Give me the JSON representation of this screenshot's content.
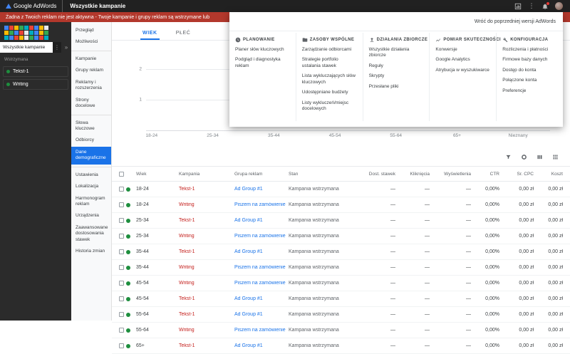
{
  "colors": {
    "accent_blue": "#1a73e8",
    "alert_red": "#b3382c",
    "campaign_link_red": "#c5221f",
    "adgroup_link_blue": "#1a73e8",
    "status_green": "#1e8e3e",
    "topbar_bg": "#212121",
    "sidebar_bg": "#2b2b2b"
  },
  "topbar": {
    "brand": "Google AdWords",
    "title": "Wszystkie kampanie",
    "icons": [
      "reports-icon",
      "more-vert-icon",
      "notifications-icon",
      "avatar"
    ]
  },
  "alert": {
    "text": "Żadna z Twoich reklam nie jest aktywna - Twoje kampanie i grupy reklam są wstrzymane lub"
  },
  "campaign_nav": {
    "all_campaigns_label": "Wszystkie kampanie",
    "section_label": "Wstrzymana",
    "campaigns": [
      "Tekst-1",
      "Writing"
    ],
    "mosaic_colors": [
      "#4285f4",
      "#ea4335",
      "#fbbc04",
      "#34a853",
      "#00acc1",
      "#ea4335",
      "#4285f4",
      "#fbbc04",
      "#e8eaed",
      "#fbbc04",
      "#34a853",
      "#4285f4",
      "#ea4335",
      "#e8eaed",
      "#00acc1",
      "#4285f4",
      "#fbbc04",
      "#34a853",
      "#00acc1",
      "#4285f4",
      "#ea4335",
      "#fbbc04",
      "#e8eaed",
      "#34a853",
      "#4285f4",
      "#ea4335",
      "#00acc1"
    ]
  },
  "menu_sidebar": {
    "items": [
      {
        "id": "przeglad",
        "label": "Przegląd",
        "selected": false,
        "divider_above": false
      },
      {
        "id": "mozliwosci",
        "label": "Możliwości",
        "selected": false,
        "divider_above": false
      },
      {
        "id": "kampanie",
        "label": "Kampanie",
        "selected": false,
        "divider_above": true
      },
      {
        "id": "grupy-reklam",
        "label": "Grupy reklam",
        "selected": false,
        "divider_above": false
      },
      {
        "id": "reklamy-i-rozszerzenia",
        "label": "Reklamy i rozszerzenia",
        "selected": false,
        "divider_above": false
      },
      {
        "id": "strony-docelowe",
        "label": "Strony docelowe",
        "selected": false,
        "divider_above": false
      },
      {
        "id": "slowa-kluczowe",
        "label": "Słowa kluczowe",
        "selected": false,
        "divider_above": true
      },
      {
        "id": "odbiorcy",
        "label": "Odbiorcy",
        "selected": false,
        "divider_above": false
      },
      {
        "id": "dane-demograficzne",
        "label": "Dane demograficzne",
        "selected": true,
        "divider_above": false
      },
      {
        "id": "ustawienia",
        "label": "Ustawienia",
        "selected": false,
        "divider_above": true
      },
      {
        "id": "lokalizacja",
        "label": "Lokalizacja",
        "selected": false,
        "divider_above": false
      },
      {
        "id": "harmonogram-reklam",
        "label": "Harmonogram reklam",
        "selected": false,
        "divider_above": false
      },
      {
        "id": "urzadzenia",
        "label": "Urządzenia",
        "selected": false,
        "divider_above": false
      },
      {
        "id": "zaawansowane-dostosowania-stawek",
        "label": "Zaawansowane dostosowania stawek",
        "selected": false,
        "divider_above": false
      },
      {
        "id": "historia-zmian",
        "label": "Historia zmian",
        "selected": false,
        "divider_above": false
      }
    ]
  },
  "tabs": [
    {
      "id": "wiek",
      "label": "WIEK",
      "selected": true
    },
    {
      "id": "plec",
      "label": "PŁEĆ",
      "selected": false
    }
  ],
  "chart_data": {
    "type": "bar",
    "title": "",
    "categories": [
      "18-24",
      "25-34",
      "35-44",
      "45-54",
      "55-64",
      "65+",
      "Nieznany"
    ],
    "values": [
      0,
      0,
      0,
      0,
      0,
      0,
      0
    ],
    "y_ticks": [
      2,
      1
    ],
    "ylim": [
      0,
      2
    ],
    "action_icons": [
      "download-icon",
      "fullscreen-icon"
    ]
  },
  "table": {
    "toolbar_icons": [
      "filter-icon",
      "segment-icon",
      "columns-icon",
      "grid-icon"
    ],
    "headers": [
      "Wiek",
      "Kampania",
      "Grupa reklam",
      "Stan",
      "Dost. stawek",
      "Kliknięcia",
      "Wyświetlenia",
      "CTR",
      "Śr. CPC",
      "Koszt"
    ],
    "rows": [
      {
        "wiek": "18-24",
        "kampania": "Tekst-1",
        "grupa": "Ad Group #1",
        "stan": "Kampania wstrzymana",
        "dost": "—",
        "klik": "—",
        "wysw": "—",
        "ctr": "0,00%",
        "cpc": "0,00 zł",
        "koszt": "0,00 zł"
      },
      {
        "wiek": "18-24",
        "kampania": "Writing",
        "grupa": "Piszem na zamówienie",
        "stan": "Kampania wstrzymana",
        "dost": "—",
        "klik": "—",
        "wysw": "—",
        "ctr": "0,00%",
        "cpc": "0,00 zł",
        "koszt": "0,00 zł"
      },
      {
        "wiek": "25-34",
        "kampania": "Tekst-1",
        "grupa": "Ad Group #1",
        "stan": "Kampania wstrzymana",
        "dost": "—",
        "klik": "—",
        "wysw": "—",
        "ctr": "0,00%",
        "cpc": "0,00 zł",
        "koszt": "0,00 zł"
      },
      {
        "wiek": "25-34",
        "kampania": "Writing",
        "grupa": "Piszem na zamówienie",
        "stan": "Kampania wstrzymana",
        "dost": "—",
        "klik": "—",
        "wysw": "—",
        "ctr": "0,00%",
        "cpc": "0,00 zł",
        "koszt": "0,00 zł"
      },
      {
        "wiek": "35-44",
        "kampania": "Tekst-1",
        "grupa": "Ad Group #1",
        "stan": "Kampania wstrzymana",
        "dost": "—",
        "klik": "—",
        "wysw": "—",
        "ctr": "0,00%",
        "cpc": "0,00 zł",
        "koszt": "0,00 zł"
      },
      {
        "wiek": "35-44",
        "kampania": "Writing",
        "grupa": "Piszem na zamówienie",
        "stan": "Kampania wstrzymana",
        "dost": "—",
        "klik": "—",
        "wysw": "—",
        "ctr": "0,00%",
        "cpc": "0,00 zł",
        "koszt": "0,00 zł"
      },
      {
        "wiek": "45-54",
        "kampania": "Writing",
        "grupa": "Piszem na zamówienie",
        "stan": "Kampania wstrzymana",
        "dost": "—",
        "klik": "—",
        "wysw": "—",
        "ctr": "0,00%",
        "cpc": "0,00 zł",
        "koszt": "0,00 zł"
      },
      {
        "wiek": "45-54",
        "kampania": "Tekst-1",
        "grupa": "Ad Group #1",
        "stan": "Kampania wstrzymana",
        "dost": "—",
        "klik": "—",
        "wysw": "—",
        "ctr": "0,00%",
        "cpc": "0,00 zł",
        "koszt": "0,00 zł"
      },
      {
        "wiek": "55-64",
        "kampania": "Tekst-1",
        "grupa": "Ad Group #1",
        "stan": "Kampania wstrzymana",
        "dost": "—",
        "klik": "—",
        "wysw": "—",
        "ctr": "0,00%",
        "cpc": "0,00 zł",
        "koszt": "0,00 zł"
      },
      {
        "wiek": "55-64",
        "kampania": "Writing",
        "grupa": "Piszem na zamówienie",
        "stan": "Kampania wstrzymana",
        "dost": "—",
        "klik": "—",
        "wysw": "—",
        "ctr": "0,00%",
        "cpc": "0,00 zł",
        "koszt": "0,00 zł"
      },
      {
        "wiek": "65+",
        "kampania": "Tekst-1",
        "grupa": "Ad Group #1",
        "stan": "Kampania wstrzymana",
        "dost": "—",
        "klik": "—",
        "wysw": "—",
        "ctr": "0,00%",
        "cpc": "0,00 zł",
        "koszt": "0,00 zł"
      }
    ]
  },
  "tools_menu": {
    "back_link": "Wróć do poprzedniej wersji AdWords",
    "sections": [
      {
        "id": "planowanie",
        "title": "PLANOWANIE",
        "icon": "planning-icon",
        "items": [
          "Planer słów kluczowych",
          "Podgląd i diagnostyka reklam"
        ]
      },
      {
        "id": "zasoby-wspolne",
        "title": "ZASOBY WSPÓLNE",
        "icon": "shared-library-icon",
        "items": [
          "Zarządzanie odbiorcami",
          "Strategie portfolio ustalania stawek",
          "Lista wykluczających słów kluczowych",
          "Udostępniane budżety",
          "Listy wykluczeń/miejsc docelowych"
        ]
      },
      {
        "id": "dzialania-zbiorcze",
        "title": "DZIAŁANIA ZBIORCZE",
        "icon": "bulk-actions-icon",
        "items": [
          "Wszystkie działania zbiorcze",
          "Reguły",
          "Skrypty",
          "Przesłane pliki"
        ]
      },
      {
        "id": "pomiar-skutecznosci",
        "title": "POMIAR SKUTECZNOŚCI",
        "icon": "measurement-icon",
        "items": [
          "Konwersje",
          "Google Analytics",
          "Atrybucja w wyszukiwarce"
        ]
      },
      {
        "id": "konfiguracja",
        "title": "KONFIGURACJA",
        "icon": "setup-icon",
        "items": [
          "Rozliczenia i płatności",
          "Firmowe bazy danych",
          "Dostęp do konta",
          "Połączone konta",
          "Preferencje"
        ]
      }
    ]
  }
}
